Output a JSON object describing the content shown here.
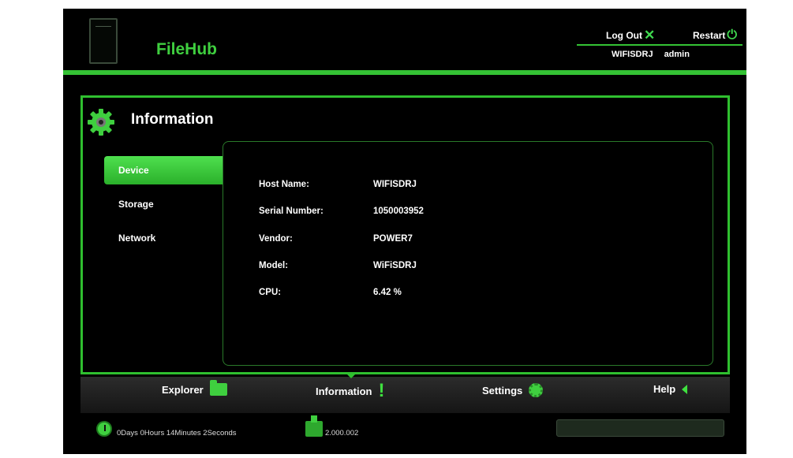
{
  "header": {
    "brand": "FileHub",
    "logout_label": "Log Out",
    "restart_label": "Restart",
    "host": "WIFISDRJ",
    "user": "admin"
  },
  "panel": {
    "title": "Information",
    "sidebar": [
      {
        "label": "Device",
        "active": true
      },
      {
        "label": "Storage",
        "active": false
      },
      {
        "label": "Network",
        "active": false
      }
    ],
    "fields": [
      {
        "label": "Host Name:",
        "value": "WIFISDRJ"
      },
      {
        "label": "Serial Number:",
        "value": "1050003952"
      },
      {
        "label": "Vendor:",
        "value": "POWER7"
      },
      {
        "label": "Model:",
        "value": "WiFiSDRJ"
      },
      {
        "label": "CPU:",
        "value": "6.42 %"
      }
    ]
  },
  "nav": {
    "explorer": "Explorer",
    "information": "Information",
    "settings": "Settings",
    "help": "Help",
    "active": "information"
  },
  "status": {
    "uptime": "0Days 0Hours 14Minutes 2Seconds",
    "version": "2.000.002"
  },
  "colors": {
    "accent": "#34c234",
    "background": "#000000"
  },
  "icons": [
    "device-icon",
    "close-icon",
    "power-icon",
    "gear-icon",
    "folder-icon",
    "exclamation-icon",
    "settings-icon",
    "back-arrow-icon",
    "clock-icon",
    "package-icon"
  ]
}
